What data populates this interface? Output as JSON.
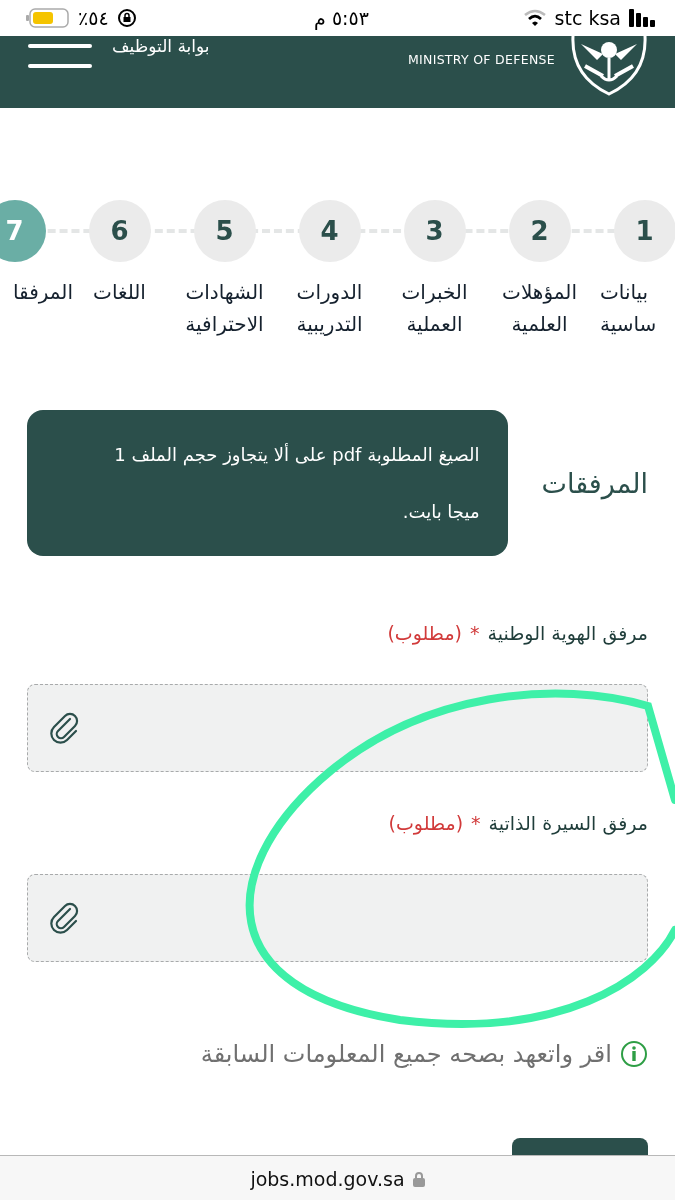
{
  "status_bar": {
    "battery": "٪٥٤",
    "time": "٥:٥٣ م",
    "carrier": "stc ksa"
  },
  "header": {
    "title": "بوابة التوظيف",
    "logo_text": "MINISTRY OF DEFENSE"
  },
  "steps": [
    {
      "number": "1",
      "lines": [
        "بيانات",
        "ساسية"
      ],
      "selected": false
    },
    {
      "number": "2",
      "lines": [
        "المؤهلات",
        "العلمية"
      ],
      "selected": false
    },
    {
      "number": "3",
      "lines": [
        "الخبرات",
        "العملية"
      ],
      "selected": false
    },
    {
      "number": "4",
      "lines": [
        "الدورات",
        "التدريبية"
      ],
      "selected": false
    },
    {
      "number": "5",
      "lines": [
        "الشهادات",
        "الاحترافية"
      ],
      "selected": false
    },
    {
      "number": "6",
      "lines": [
        "اللغات"
      ],
      "selected": false
    },
    {
      "number": "7",
      "lines": [
        "المرفقا"
      ],
      "selected": true
    }
  ],
  "section_title": "المرفقات",
  "notice": "الصيغ المطلوبة  pdf على ألا يتجاوز حجم الملف 1 ميجا بايت.",
  "fields": [
    {
      "label": "مرفق الهوية الوطنية",
      "required_mark": "*",
      "required_text": "(مطلوب)"
    },
    {
      "label": "مرفق السيرة الذاتية",
      "required_mark": "*",
      "required_text": "(مطلوب)"
    }
  ],
  "declaration": "اقر واتعهد بصحه جميع المعلومات السابقة",
  "url": "jobs.mod.gov.sa"
}
